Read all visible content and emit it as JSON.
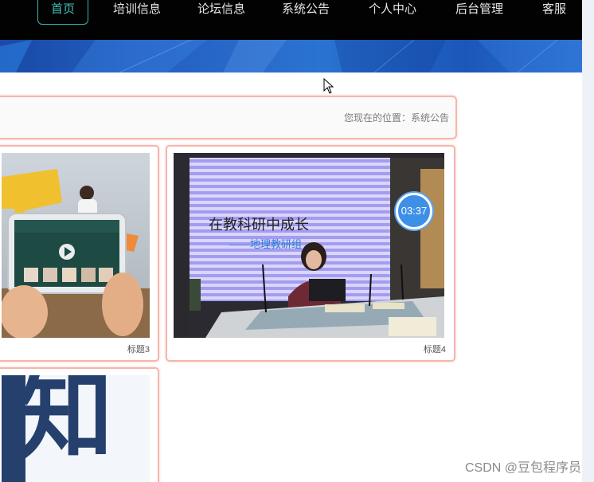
{
  "nav": {
    "items": [
      "首页",
      "培训信息",
      "论坛信息",
      "系统公告",
      "个人中心",
      "后台管理",
      "客服"
    ],
    "active_index": 0
  },
  "breadcrumb": {
    "text": "您现在的位置：系统公告"
  },
  "cards": [
    {
      "caption": "标题3"
    },
    {
      "caption": "标题4",
      "timer": "03:37",
      "slide_title": "在教科研中成长",
      "slide_subtitle": "——地理教研组"
    },
    {
      "caption": ""
    }
  ],
  "third_card": {
    "big_text": "知"
  },
  "watermark": "CSDN @豆包程序员",
  "colors": {
    "nav_bg": "#020203",
    "nav_active": "#33b5ad",
    "card_border": "#f6b5ad",
    "timer_bg": "#3d8fe8",
    "banner": "#235fc0"
  }
}
